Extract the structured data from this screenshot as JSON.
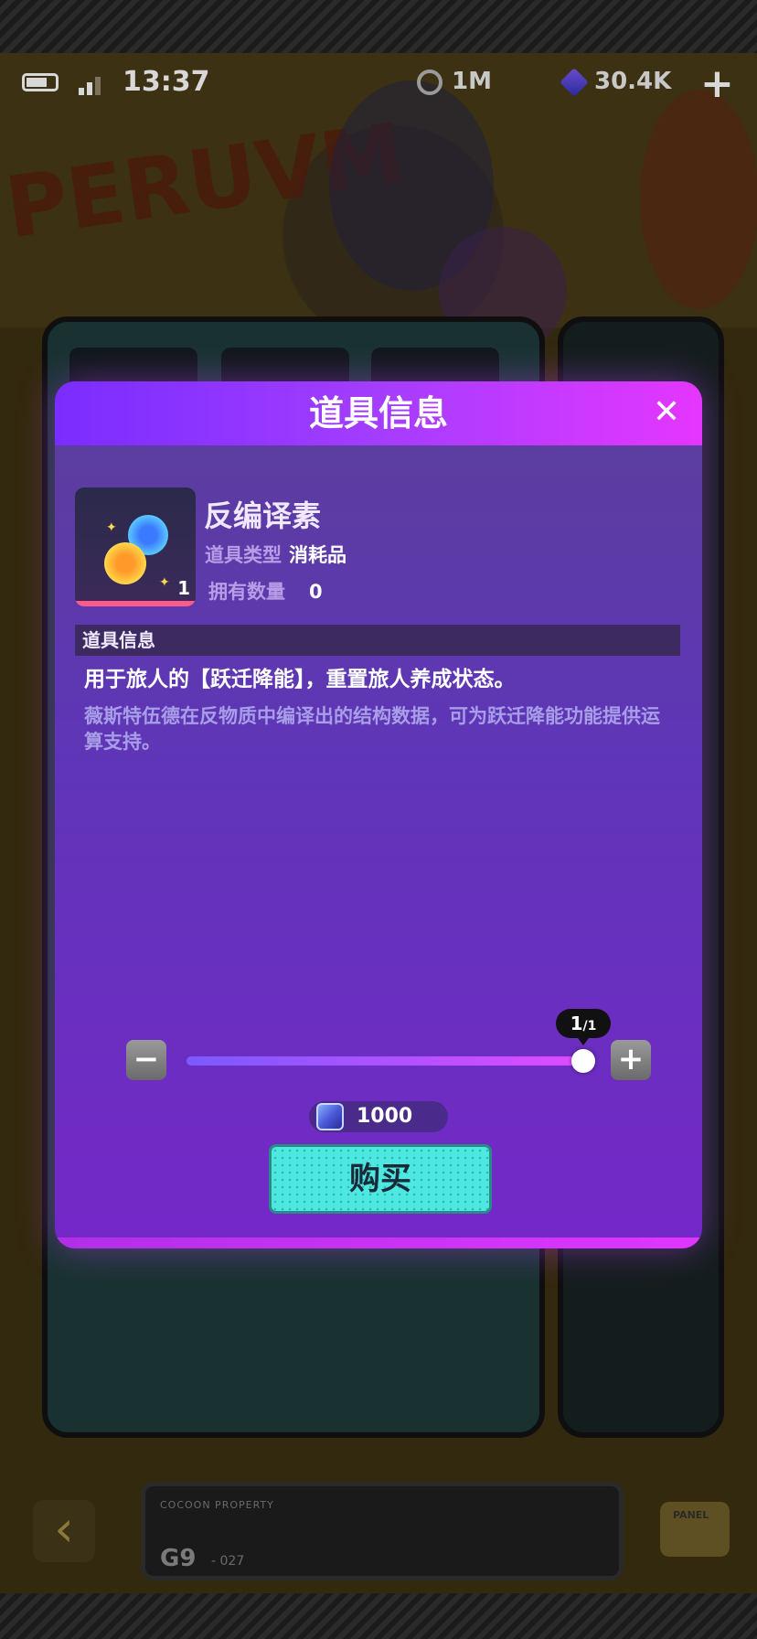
{
  "status_bar": {
    "time": "13:37",
    "coins": "1M",
    "gems": "30.4K",
    "add_symbol": "+"
  },
  "background": {
    "logo_text": "PERUVM"
  },
  "modal": {
    "title": "道具信息",
    "close_symbol": "✕",
    "item": {
      "name": "反编译素",
      "icon_count": "1",
      "type_label": "道具类型",
      "type_value": "消耗品",
      "owned_label": "拥有数量",
      "owned_value": "0"
    },
    "info_header": "道具信息",
    "info_main": "用于旅人的【跃迁降能】，重置旅人养成状态。",
    "info_sub": "薇斯特伍德在反物质中编译出的结构数据，可为跃迁降能功能提供运算支持。",
    "quantity": {
      "current": "1",
      "max": "/1",
      "minus_symbol": "−",
      "plus_symbol": "+",
      "fill_fraction": 1.0
    },
    "price": "1000",
    "buy_label": "购买"
  },
  "bottom": {
    "back_symbol": "‹",
    "cocoon_label": "COCOON PROPERTY",
    "cocoon_code": "G9",
    "cocoon_sub": "- 027",
    "panel_label": "PANEL"
  },
  "colors": {
    "modal_header_start": "#7a2dff",
    "modal_header_end": "#e536ff",
    "buy_button": "#4ee8e0",
    "slider_fill_end": "#e04aff"
  },
  "icons": [
    "battery-icon",
    "signal-icon",
    "coin-icon",
    "gem-cube-icon",
    "close-icon",
    "orb-icon",
    "cube-price-icon",
    "back-arrow-icon"
  ]
}
